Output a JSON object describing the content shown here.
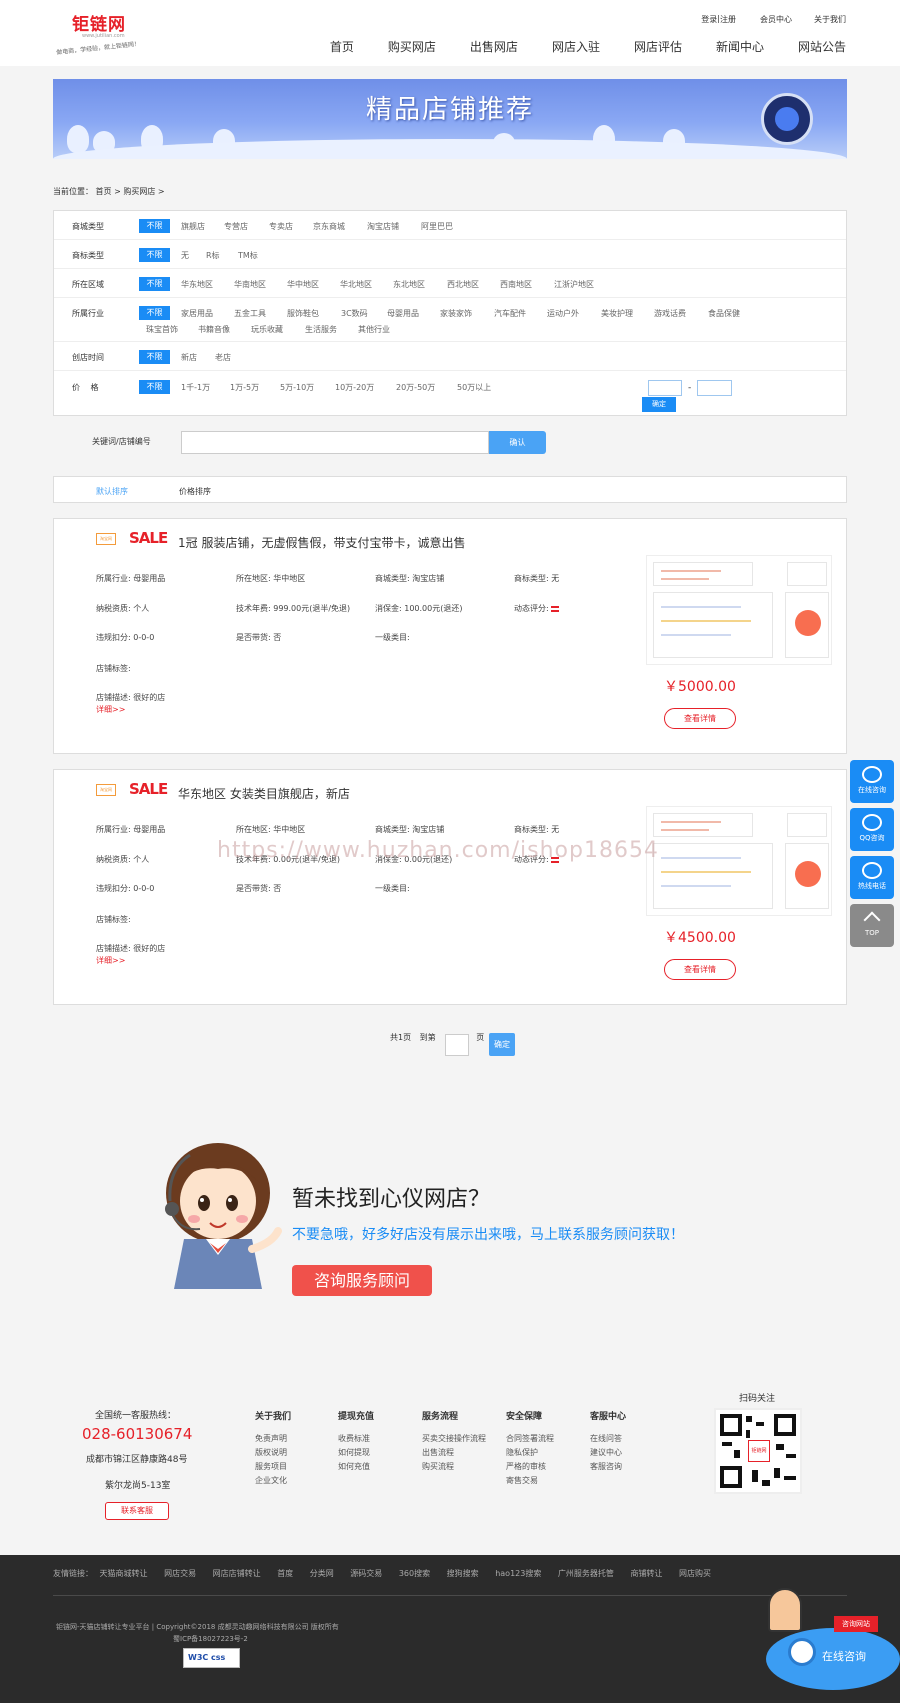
{
  "site": {
    "logo_text": "钜链网",
    "logo_sub": "www.jutilian.com",
    "logo_tagline": "做电商，学经验，就上钜链网！"
  },
  "topbar": {
    "login": "登录",
    "sep": " | ",
    "register": "注册",
    "member": "会员中心",
    "about": "关于我们"
  },
  "nav": {
    "items": [
      "首页",
      "购买网店",
      "出售网店",
      "网店入驻",
      "网店评估",
      "新闻中心",
      "网站公告"
    ]
  },
  "banner": {
    "title": "精品店铺推荐"
  },
  "breadcrumb": {
    "text": "当前位置： 首页 > 购买网店 >"
  },
  "filters": {
    "selected_label": "不限",
    "rows": [
      {
        "label": "商城类型",
        "options": [
          "旗舰店",
          "专营店",
          "专卖店",
          "京东商城",
          "淘宝店铺",
          "阿里巴巴"
        ]
      },
      {
        "label": "商标类型",
        "options": [
          "无",
          "R标",
          "TM标"
        ]
      },
      {
        "label": "所在区域",
        "options": [
          "华东地区",
          "华南地区",
          "华中地区",
          "华北地区",
          "东北地区",
          "西北地区",
          "西南地区",
          "江浙沪地区"
        ]
      },
      {
        "label": "所属行业",
        "options": [
          "家居用品",
          "五金工具",
          "服饰鞋包",
          "3C数码",
          "母婴用品",
          "家装家饰",
          "汽车配件",
          "运动户外",
          "美妆护理",
          "游戏话费",
          "食品保健"
        ],
        "options2": [
          "珠宝首饰",
          "书籍音像",
          "玩乐收藏",
          "生活服务",
          "其他行业"
        ]
      },
      {
        "label": "创店时间",
        "options": [
          "新店",
          "老店"
        ]
      },
      {
        "label": "价　 格",
        "options": [
          "1千-1万",
          "1万-5万",
          "5万-10万",
          "10万-20万",
          "20万-50万",
          "50万以上"
        ]
      }
    ],
    "price_dash": "-",
    "price_ok": "确定",
    "keyword_label": "关键词/店铺编号",
    "keyword_value": "",
    "keyword_button": "确认"
  },
  "sort": {
    "default": "默认排序",
    "price": "价格排序"
  },
  "listings": [
    {
      "platform_logo": "淘宝网",
      "sale": "SALE",
      "title": "1冠 服装店铺，无虚假售假，带支付宝带卡，诚意出售",
      "row1": [
        "所属行业: 母婴用品",
        "所在地区: 华中地区",
        "商城类型: 淘宝店铺",
        "商标类型: 无"
      ],
      "row2": [
        "纳税资质: 个人",
        "技术年费: 999.00元(退半/免退)",
        "消保金: 100.00元(退还)",
        "动态评分: "
      ],
      "row3": [
        "违规扣分: 0-0-0",
        "是否带货: 否",
        "一级类目: "
      ],
      "tags": "店铺标签:",
      "desc": "店铺描述: 很好的店",
      "more": "详细>>",
      "price": "￥5000.00",
      "detail_button": "查看详情"
    },
    {
      "platform_logo": "淘宝网",
      "sale": "SALE",
      "title": "华东地区 女装类目旗舰店，新店",
      "row1": [
        "所属行业: 母婴用品",
        "所在地区: 华中地区",
        "商城类型: 淘宝店铺",
        "商标类型: 无"
      ],
      "row2": [
        "纳税资质: 个人",
        "技术年费: 0.00元(退半/免退)",
        "消保金: 0.00元(退还)",
        "动态评分: "
      ],
      "row3": [
        "违规扣分: 0-0-0",
        "是否带货: 否",
        "一级类目: "
      ],
      "tags": "店铺标签:",
      "desc": "店铺描述: 很好的店",
      "more": "详细>>",
      "price": "￥4500.00",
      "detail_button": "查看详情"
    }
  ],
  "watermark": "https://www.huzhan.com/ishop18654",
  "pager": {
    "total": "共1页",
    "goto": "到第",
    "page_value": "",
    "unit": "页",
    "ok": "确定"
  },
  "cta": {
    "title": "暂未找到心仪网店？",
    "subtitle": "不要急哦，好多好店没有展示出来哦，马上联系服务顾问获取！",
    "button": "咨询服务顾问"
  },
  "footer": {
    "hotline_label": "全国统一客服热线：",
    "hotline": "028-60130674",
    "address1": "成都市锦江区静康路48号",
    "address2": "紫尔龙尚5-13室",
    "contact_button": "联系客服",
    "columns": [
      {
        "title": "关于我们",
        "items": [
          "免责声明",
          "版权说明",
          "服务项目",
          "企业文化"
        ]
      },
      {
        "title": "提现充值",
        "items": [
          "收费标准",
          "如何提现",
          "如何充值"
        ]
      },
      {
        "title": "服务流程",
        "items": [
          "买卖交接操作流程",
          "出售流程",
          "购买流程"
        ]
      },
      {
        "title": "安全保障",
        "items": [
          "合同签署流程",
          "隐私保护",
          "严格的审核",
          "寄售交易"
        ]
      },
      {
        "title": "客服中心",
        "items": [
          "在线问答",
          "建议中心",
          "客服咨询"
        ]
      }
    ],
    "qr_label": "扫码关注",
    "qr_center": "钜链网",
    "friend_links_label": "友情链接：",
    "friend_links": [
      "天猫商城转让",
      "网店交易",
      "网店店铺转让",
      "首度",
      "分类网",
      "源码交易",
      "360搜索",
      "搜狗搜索",
      "hao123搜索",
      "广州服务器托管",
      "商铺转让",
      "网店购买"
    ],
    "copyright": "钜链网-天猫店铺转让专业平台 | Copyright©2018 成都灵动趣网络科技有限公司 版权所有",
    "icp": "蜀ICP备18027223号-2",
    "w3c": "W3C css"
  },
  "side_tools": {
    "online": "在线咨询",
    "qq": "QQ咨询",
    "phone": "热线电话",
    "top": "TOP"
  },
  "consult_widget": {
    "label": "在线咨询",
    "tag": "咨询网站"
  },
  "colors": {
    "accent_blue": "#1a8cf5",
    "accent_red": "#e62129",
    "side_blue": "#1a8cf5",
    "side_gray": "#8a8a8a"
  }
}
